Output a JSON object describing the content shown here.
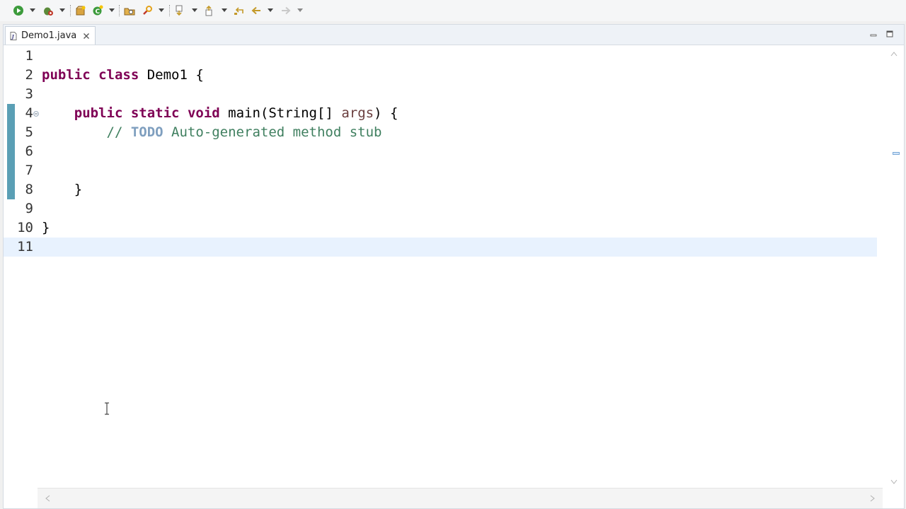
{
  "toolbar": {
    "icons": [
      "run-icon",
      "debug-icon",
      "new-java-package-icon",
      "new-java-class-icon",
      "open-type-icon",
      "search-icon",
      "next-annotation-icon",
      "previous-annotation-icon",
      "last-edit-location-icon",
      "back-icon",
      "forward-icon"
    ]
  },
  "editor": {
    "tab": {
      "label": "Demo1.java"
    },
    "lines": [
      {
        "number": "1"
      },
      {
        "number": "2",
        "tokens": [
          [
            "kw",
            "public"
          ],
          [
            "plain",
            " "
          ],
          [
            "kw",
            "class"
          ],
          [
            "plain",
            " Demo1 {"
          ]
        ]
      },
      {
        "number": "3"
      },
      {
        "number": "4",
        "tokens": [
          [
            "plain",
            "    "
          ],
          [
            "kw",
            "public"
          ],
          [
            "plain",
            " "
          ],
          [
            "kw",
            "static"
          ],
          [
            "plain",
            " "
          ],
          [
            "kw",
            "void"
          ],
          [
            "plain",
            " main(String[] "
          ],
          [
            "var",
            "args"
          ],
          [
            "plain",
            ") {"
          ]
        ]
      },
      {
        "number": "5",
        "tokens": [
          [
            "plain",
            "        "
          ],
          [
            "cm",
            "// "
          ],
          [
            "todo",
            "TODO"
          ],
          [
            "cm",
            " Auto-generated method stub"
          ]
        ]
      },
      {
        "number": "6"
      },
      {
        "number": "7"
      },
      {
        "number": "8",
        "tokens": [
          [
            "plain",
            "    }"
          ]
        ]
      },
      {
        "number": "9"
      },
      {
        "number": "10",
        "tokens": [
          [
            "plain",
            "}"
          ]
        ]
      },
      {
        "number": "11"
      }
    ]
  },
  "colors": {
    "keyword": "#7f0055",
    "comment": "#3f7f5f",
    "todo": "#7f9fbf",
    "local_variable": "#6a3e3e",
    "current_line": "#e8f2fe",
    "change_bar": "#5a9fb5"
  }
}
